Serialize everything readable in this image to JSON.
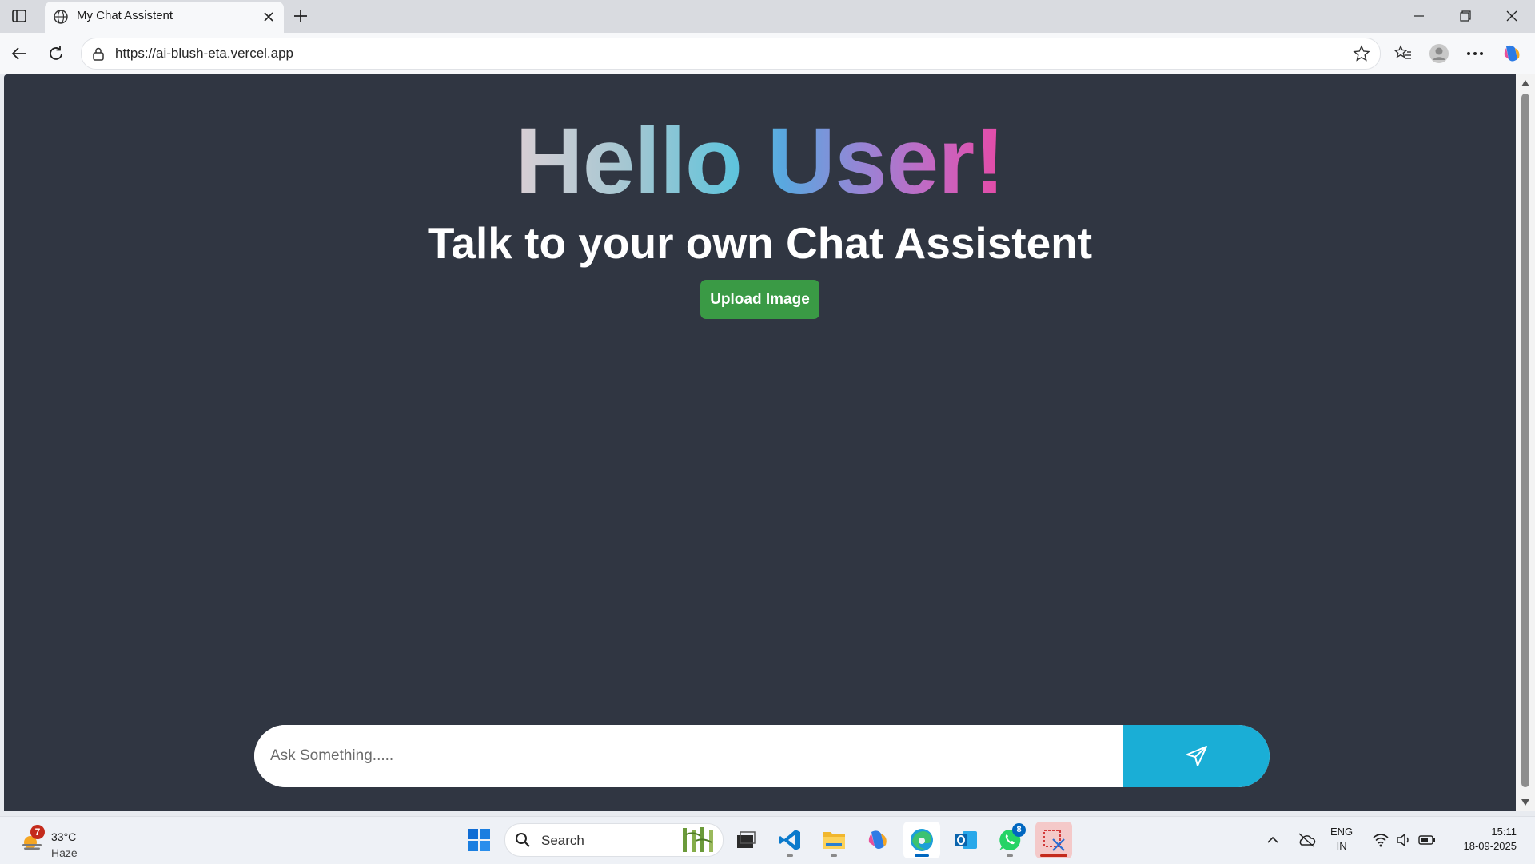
{
  "browser": {
    "tab_title": "My Chat Assistent",
    "url": "https://ai-blush-eta.vercel.app"
  },
  "page": {
    "heading": "Hello User!",
    "subtitle": "Talk to your own Chat Assistent",
    "upload_label": "Upload Image",
    "chat_placeholder": "Ask Something.....",
    "colors": {
      "background": "#303642",
      "upload_button": "#3a9a45",
      "send_button": "#1aaed6",
      "heading_gradient": [
        "#d9cfd4",
        "#5fc4dc",
        "#9b82d4",
        "#e54aa6"
      ]
    }
  },
  "taskbar": {
    "weather": {
      "temp": "33°C",
      "condition": "Haze",
      "badge": "7"
    },
    "search_label": "Search",
    "whatsapp_badge": "8",
    "language": {
      "line1": "ENG",
      "line2": "IN"
    },
    "time": "15:11",
    "date": "18-09-2025",
    "apps": [
      "start-icon",
      "search",
      "task-view-icon",
      "vscode-icon",
      "file-explorer-icon",
      "copilot-icon",
      "edge-icon",
      "outlook-icon",
      "whatsapp-icon",
      "snipping-tool-icon"
    ]
  }
}
